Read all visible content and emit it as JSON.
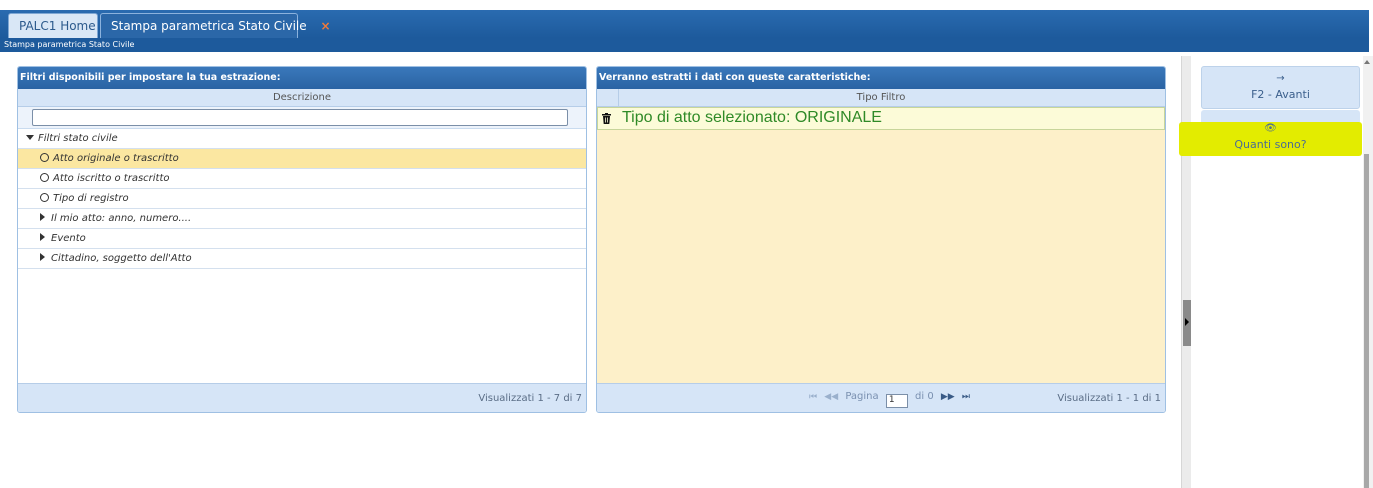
{
  "tabs": [
    {
      "label": "PALC1 Home"
    },
    {
      "label": "Stampa parametrica Stato Civile",
      "close": "×"
    }
  ],
  "breadcrumb": "Stampa parametrica Stato Civile",
  "left_panel": {
    "title": "Filtri disponibili per impostare la tua estrazione:",
    "column": "Descrizione",
    "search": {
      "value": "",
      "placeholder": ""
    },
    "tree": [
      {
        "label": "Filtri stato civile",
        "kind": "group-expanded"
      },
      {
        "label": "Atto originale o trascritto",
        "kind": "radio",
        "selected": true
      },
      {
        "label": "Atto iscritto o trascritto",
        "kind": "radio"
      },
      {
        "label": "Tipo di registro",
        "kind": "radio"
      },
      {
        "label": "Il mio atto: anno, numero....",
        "kind": "collapsed"
      },
      {
        "label": "Evento",
        "kind": "collapsed"
      },
      {
        "label": "Cittadino, soggetto dell'Atto",
        "kind": "collapsed"
      }
    ],
    "footer": "Visualizzati 1 - 7 di 7"
  },
  "right_panel": {
    "title": "Verranno estratti i dati con queste caratteristiche:",
    "column": "Tipo Filtro",
    "rows": [
      {
        "text": "Tipo di atto selezionato: ORIGINALE",
        "icon": "trash-icon"
      }
    ],
    "pager": {
      "label": "Pagina",
      "page": "1",
      "of": "di 0"
    },
    "footer": "Visualizzati 1 - 1 di 1"
  },
  "actions": {
    "avanti": {
      "icon": "→",
      "label": "F2 - Avanti"
    },
    "quanti": {
      "icon": "👁",
      "label": "Quanti sono?",
      "highlight": "#e3ec00"
    }
  },
  "colors": {
    "header_blue": "#2a63a3",
    "selected_row": "#fbe7a1",
    "result_text": "#2f8a27"
  }
}
